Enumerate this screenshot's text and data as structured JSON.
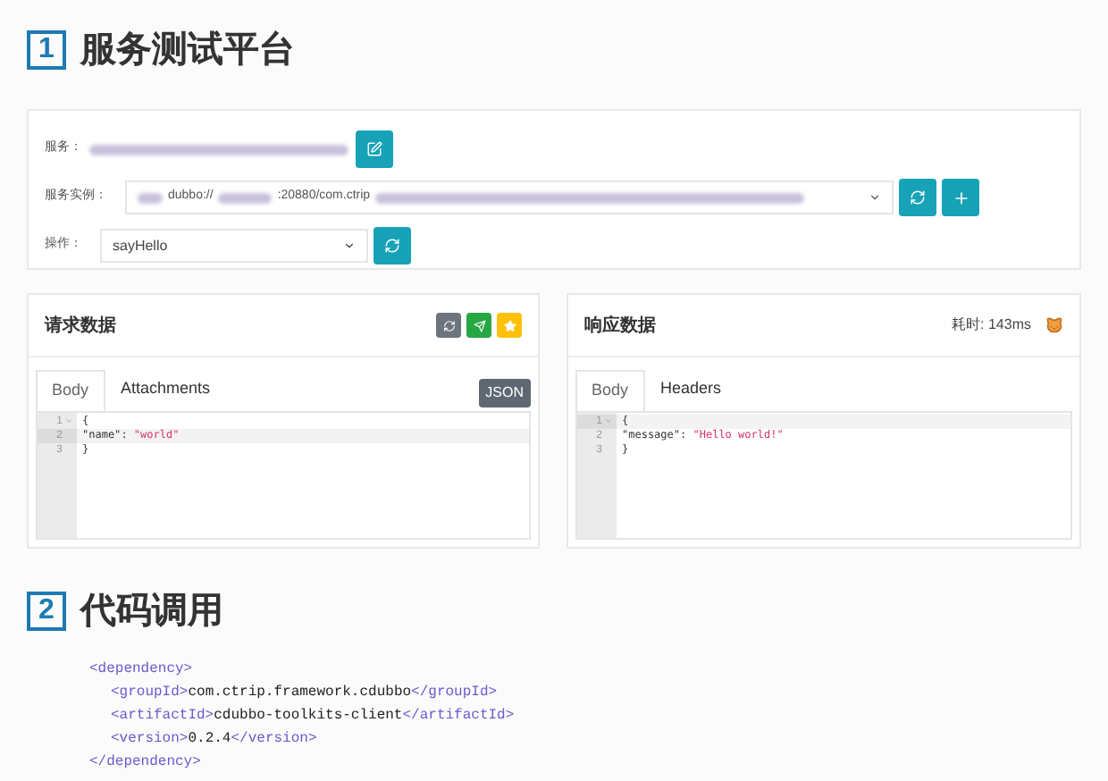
{
  "section_1": {
    "number": "1",
    "title": "服务测试平台"
  },
  "form": {
    "service": {
      "label": "服务："
    },
    "instance": {
      "label": "服务实例：",
      "value_prefix": "dubbo://",
      "value_middle": ":20880/com.ctrip"
    },
    "operation": {
      "label": "操作：",
      "value": "sayHello"
    }
  },
  "request": {
    "title": "请求数据",
    "tabs": [
      {
        "label": "Body",
        "selected": true
      },
      {
        "label": "Attachments",
        "selected": false
      }
    ],
    "format_button": "JSON",
    "lines": [
      {
        "number": "1",
        "fold": true,
        "active": false,
        "segments": [
          {
            "kind": "punct",
            "text": "{"
          }
        ]
      },
      {
        "number": "2",
        "fold": false,
        "active": true,
        "segments": [
          {
            "kind": "key",
            "text": "\"name\""
          },
          {
            "kind": "punct",
            "text": ": "
          },
          {
            "kind": "string",
            "text": "\"world\""
          }
        ]
      },
      {
        "number": "3",
        "fold": false,
        "active": false,
        "segments": [
          {
            "kind": "punct",
            "text": "}"
          }
        ]
      }
    ]
  },
  "response": {
    "title": "响应数据",
    "elapsed": "耗时: 143ms",
    "tabs": [
      {
        "label": "Body",
        "selected": true
      },
      {
        "label": "Headers",
        "selected": false
      }
    ],
    "lines": [
      {
        "number": "1",
        "fold": true,
        "active": true,
        "segments": [
          {
            "kind": "punct",
            "text": "{"
          }
        ]
      },
      {
        "number": "2",
        "fold": false,
        "active": false,
        "segments": [
          {
            "kind": "key",
            "text": "\"message\""
          },
          {
            "kind": "punct",
            "text": ": "
          },
          {
            "kind": "string",
            "text": "\"Hello world!\""
          }
        ]
      },
      {
        "number": "3",
        "fold": false,
        "active": false,
        "segments": [
          {
            "kind": "punct",
            "text": "}"
          }
        ]
      }
    ]
  },
  "section_2": {
    "number": "2",
    "title": "代码调用"
  },
  "code": {
    "open": "<dependency>",
    "close": "</dependency>",
    "children": [
      {
        "open": "<groupId>",
        "value": "com.ctrip.framework.cdubbo",
        "close": "</groupId>"
      },
      {
        "open": "<artifactId>",
        "value": "cdubbo-toolkits-client",
        "close": "</artifactId>"
      },
      {
        "open": "<version>",
        "value": "0.2.4",
        "close": "</version>"
      }
    ]
  }
}
